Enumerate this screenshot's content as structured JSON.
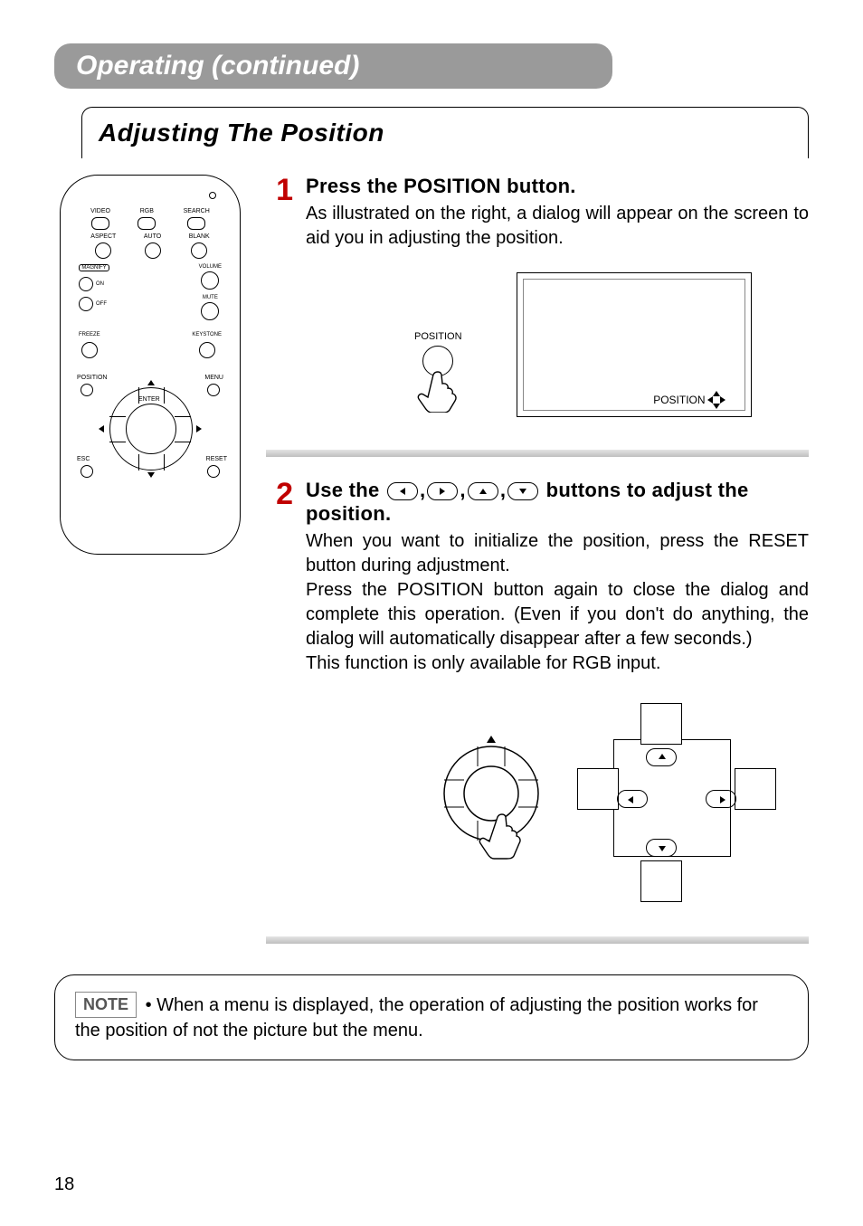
{
  "chapter_title": "Operating (continued)",
  "section_title": "Adjusting The Position",
  "remote": {
    "row1": [
      "VIDEO",
      "RGB",
      "SEARCH"
    ],
    "row2": [
      "ASPECT",
      "AUTO",
      "BLANK"
    ],
    "magnify": "MAGNIFY",
    "on": "ON",
    "off": "OFF",
    "volume": "VOLUME",
    "mute": "MUTE",
    "freeze": "FREEZE",
    "keystone": "KEYSTONE",
    "position": "POSITION",
    "menu": "MENU",
    "enter": "ENTER",
    "esc": "ESC",
    "reset": "RESET"
  },
  "steps": [
    {
      "num": "1",
      "heading": "Press the POSITION button.",
      "body": "As illustrated on the right, a dialog will appear on the screen to aid you in adjusting the position.",
      "diagram_label": "POSITION",
      "screen_label": "POSITION"
    },
    {
      "num": "2",
      "heading_pre": "Use the ",
      "heading_post": " buttons to adjust the position.",
      "body": "When you want to initialize the position, press the RESET button during adjustment.\nPress the POSITION button again to close the dialog and complete this operation.  (Even if you don't do anything, the dialog will automatically disappear after a few seconds.)\nThis function is only available for RGB input."
    }
  ],
  "note": {
    "tag": "NOTE",
    "text": "• When a menu is displayed, the operation of adjusting the position works for the position of not the picture but the menu."
  },
  "page_number": "18"
}
